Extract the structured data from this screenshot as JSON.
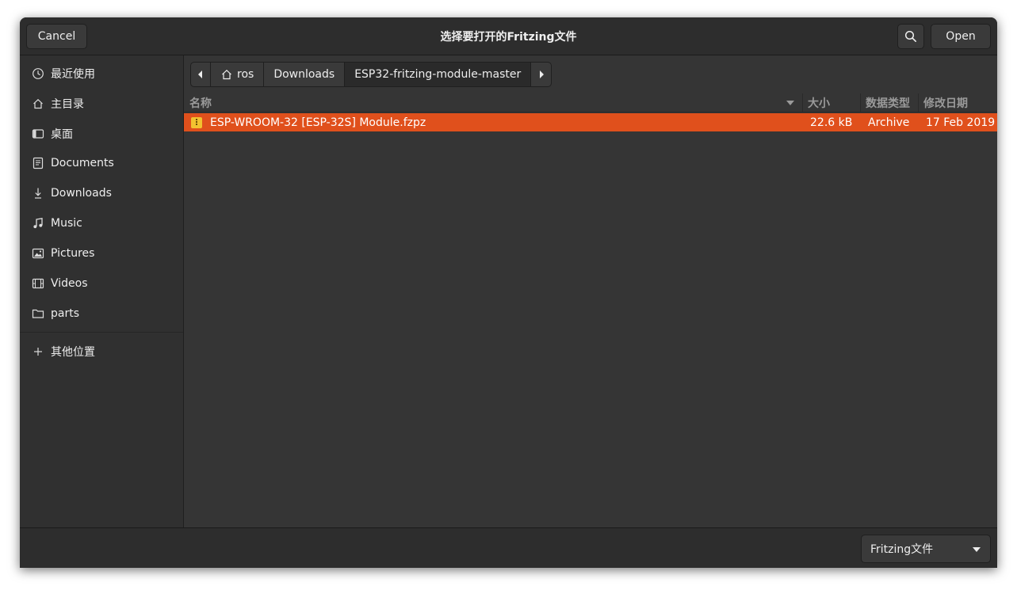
{
  "header": {
    "cancel_label": "Cancel",
    "title": "选择要打开的Fritzing文件",
    "open_label": "Open"
  },
  "sidebar": {
    "items": [
      {
        "label": "最近使用",
        "icon": "clock-icon"
      },
      {
        "label": "主目录",
        "icon": "home-icon"
      },
      {
        "label": "桌面",
        "icon": "desktop-icon"
      },
      {
        "label": "Documents",
        "icon": "document-icon"
      },
      {
        "label": "Downloads",
        "icon": "download-icon"
      },
      {
        "label": "Music",
        "icon": "music-icon"
      },
      {
        "label": "Pictures",
        "icon": "picture-icon"
      },
      {
        "label": "Videos",
        "icon": "video-icon"
      },
      {
        "label": "parts",
        "icon": "folder-icon"
      }
    ],
    "other_locations": "其他位置"
  },
  "pathbar": {
    "segments": [
      "ros",
      "Downloads",
      "ESP32-fritzing-module-master"
    ]
  },
  "columns": {
    "name": "名称",
    "size": "大小",
    "type": "数据类型",
    "modified": "修改日期"
  },
  "files": [
    {
      "name": "ESP-WROOM-32 [ESP-32S] Module.fzpz",
      "size": "22.6 kB",
      "type": "Archive",
      "modified": "17 Feb 2019",
      "icon": "archive-icon",
      "selected": true
    }
  ],
  "footer": {
    "filter_label": "Fritzing文件"
  },
  "colors": {
    "accent": "#e0501c",
    "window_bg": "#353535",
    "sidebar_bg": "#303030",
    "header_bg": "#2d2d2d"
  }
}
